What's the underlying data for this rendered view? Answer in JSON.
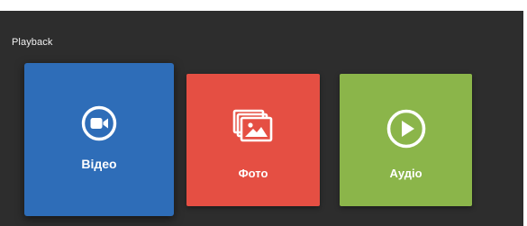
{
  "section": {
    "title": "Playback"
  },
  "tiles": [
    {
      "label": "Відео",
      "icon": "video-camera-icon",
      "color": "#2e6db8",
      "selected": true
    },
    {
      "label": "Фото",
      "icon": "photo-gallery-icon",
      "color": "#e54f43",
      "selected": false
    },
    {
      "label": "Аудіо",
      "icon": "play-circle-icon",
      "color": "#8bb54a",
      "selected": false
    }
  ]
}
